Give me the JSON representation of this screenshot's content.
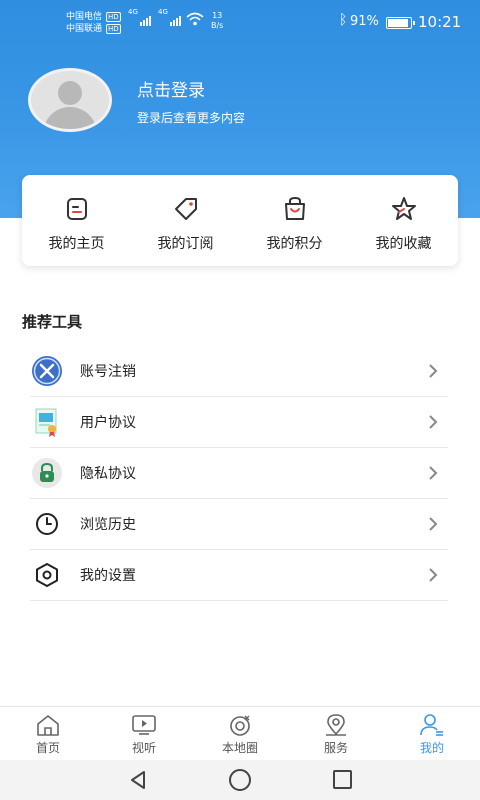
{
  "status_bar": {
    "carrier1": "中国电信",
    "carrier2": "中国联通",
    "hd": "HD",
    "net1": "4G",
    "net2": "4G",
    "speed_value": "13",
    "speed_unit": "B/s",
    "battery_pct": "91%",
    "battery_level": 0.91,
    "time": "10:21"
  },
  "profile": {
    "login_title": "点击登录",
    "login_subtitle": "登录后查看更多内容"
  },
  "quick_links": [
    {
      "label": "我的主页",
      "icon": "homepage-card-icon"
    },
    {
      "label": "我的订阅",
      "icon": "tag-icon"
    },
    {
      "label": "我的积分",
      "icon": "shopping-bag-icon"
    },
    {
      "label": "我的收藏",
      "icon": "star-icon"
    }
  ],
  "tools": {
    "title": "推荐工具",
    "items": [
      {
        "label": "账号注销",
        "icon": "close-circle-icon"
      },
      {
        "label": "用户协议",
        "icon": "document-certificate-icon"
      },
      {
        "label": "隐私协议",
        "icon": "lock-icon"
      },
      {
        "label": "浏览历史",
        "icon": "clock-icon"
      },
      {
        "label": "我的设置",
        "icon": "hexagon-settings-icon"
      }
    ]
  },
  "bottom_nav": {
    "items": [
      {
        "label": "首页",
        "icon": "home-icon"
      },
      {
        "label": "视听",
        "icon": "tv-icon"
      },
      {
        "label": "本地圈",
        "icon": "local-circle-icon"
      },
      {
        "label": "服务",
        "icon": "map-pin-icon"
      },
      {
        "label": "我的",
        "icon": "user-icon"
      }
    ],
    "active_index": 4
  },
  "colors": {
    "primary": "#3a97e6",
    "header_top": "#2f8ee0",
    "icon_dark": "#333333",
    "accent_red": "#e64545"
  }
}
